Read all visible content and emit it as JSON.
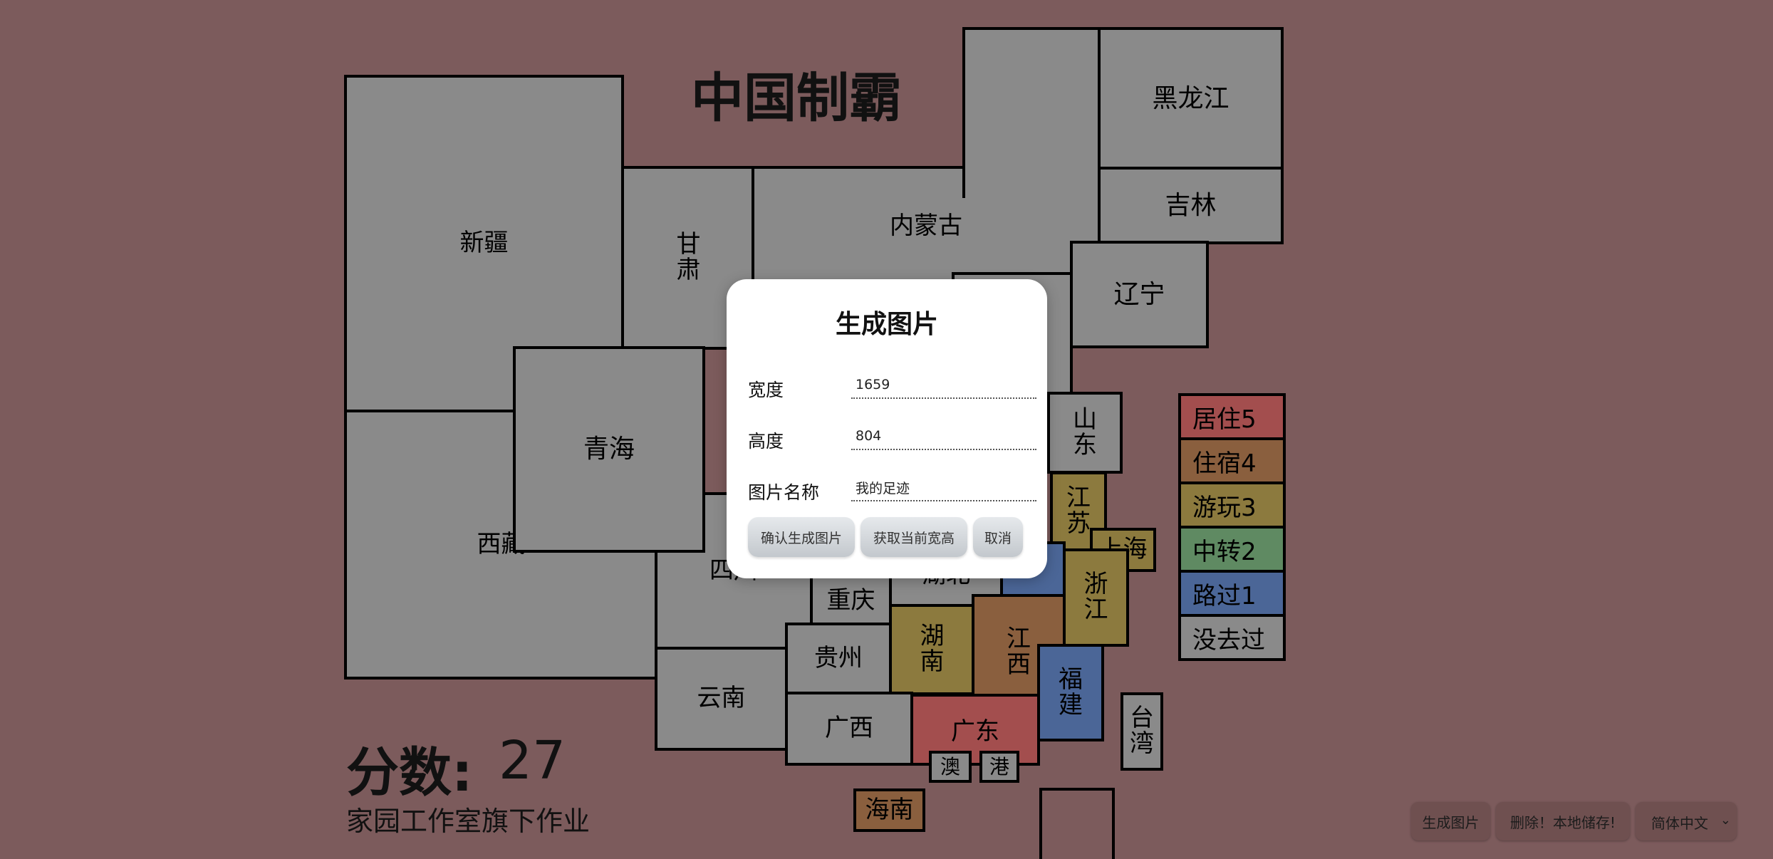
{
  "title": "中国制霸",
  "score": {
    "label": "分数:",
    "value": "27"
  },
  "credit": "家园工作室旗下作业",
  "colors": {
    "background": "#7c5b5c",
    "level_5": "#a34e4e",
    "level_4": "#8a5f3e",
    "level_3": "#8c7a3e",
    "level_2": "#5f8a62",
    "level_1": "#4b6697",
    "level_0": "#8a8a8a"
  },
  "provinces": {
    "heilongjiang": {
      "label": "黑龙江",
      "level": 0
    },
    "jilin": {
      "label": "吉林",
      "level": 0
    },
    "liaoning": {
      "label": "辽宁",
      "level": 0
    },
    "neimenggu": {
      "label": "内蒙古",
      "level": 0
    },
    "xinjiang": {
      "label": "新疆",
      "level": 0
    },
    "gansu": {
      "label": "甘肃",
      "level": 0
    },
    "qinghai": {
      "label": "青海",
      "level": 0
    },
    "xizang": {
      "label": "西藏",
      "level": 0
    },
    "sichuan": {
      "label": "四川",
      "level": 0
    },
    "chongqing": {
      "label": "重庆",
      "level": 0
    },
    "guizhou": {
      "label": "贵州",
      "level": 0
    },
    "yunnan": {
      "label": "云南",
      "level": 0
    },
    "guangxi": {
      "label": "广西",
      "level": 0
    },
    "hubei": {
      "label": "湖北",
      "level": 0
    },
    "hunan": {
      "label": "湖南",
      "level": 3
    },
    "jiangxi": {
      "label": "江西",
      "level": 4
    },
    "fujian": {
      "label": "福建",
      "level": 1
    },
    "guangdong": {
      "label": "广东",
      "level": 5
    },
    "macau": {
      "label": "澳",
      "level": 0
    },
    "hongkong": {
      "label": "港",
      "level": 0
    },
    "hainan": {
      "label": "海南",
      "level": 4
    },
    "taiwan": {
      "label": "台湾",
      "level": 0
    },
    "shandong": {
      "label": "山东",
      "level": 0
    },
    "jiangsu": {
      "label": "江苏",
      "level": 3
    },
    "shanghai": {
      "label": "上海",
      "level": 3
    },
    "zhejiang": {
      "label": "浙江",
      "level": 3
    },
    "anhui": {
      "label": "",
      "level": 1
    }
  },
  "legend": [
    {
      "label": "居住5",
      "level": 5
    },
    {
      "label": "住宿4",
      "level": 4
    },
    {
      "label": "游玩3",
      "level": 3
    },
    {
      "label": "中转2",
      "level": 2
    },
    {
      "label": "路过1",
      "level": 1
    },
    {
      "label": "没去过",
      "level": 0
    }
  ],
  "dialog": {
    "title": "生成图片",
    "fields": {
      "width": {
        "label": "宽度",
        "value": "1659"
      },
      "height": {
        "label": "高度",
        "value": "804"
      },
      "name": {
        "label": "图片名称",
        "value": "我的足迹"
      }
    },
    "buttons": {
      "confirm": "确认生成图片",
      "get_size": "获取当前宽高",
      "cancel": "取消"
    }
  },
  "toolbar": {
    "generate": "生成图片",
    "delete": "删除！本地储存!",
    "language": {
      "selected": "简体中文",
      "chevron_icon": "chevron-down-icon"
    }
  }
}
